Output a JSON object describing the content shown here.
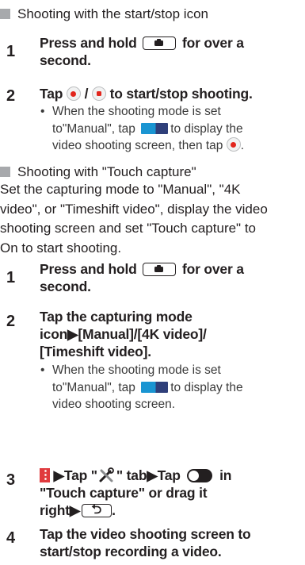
{
  "section1": {
    "heading": "Shooting with the start/stop icon",
    "steps": [
      {
        "num": "1",
        "text_a": "Press and hold",
        "text_b": "for over a",
        "text_c": "second."
      },
      {
        "num": "2",
        "text_a": "Tap",
        "text_b": "/",
        "text_c": "to start/stop shooting."
      }
    ],
    "note": {
      "line1": "When the shooting mode is set",
      "line2_a": "to\"Manual\", tap",
      "line2_b": "to display the",
      "line3_a": "video shooting screen, then tap",
      "line3_b": "."
    }
  },
  "section2": {
    "heading": "Shooting with \"Touch capture\"",
    "para_lines": [
      "Set the capturing mode to \"Manual\", \"4K",
      "video\", or \"Timeshift video\", display the video",
      "shooting screen and set \"Touch capture\" to",
      "On to start shooting."
    ],
    "steps": [
      {
        "num": "1",
        "text_a": "Press and hold",
        "text_b": "for over a",
        "text_c": "second."
      },
      {
        "num": "2",
        "line1": "Tap the capturing mode",
        "line2": "icon▶[Manual]/[4K video]/",
        "line3": "[Timeshift video]."
      },
      {
        "num": "3",
        "part1": "▶Tap \"",
        "part2": "\" tab▶Tap",
        "part3": "in",
        "line2": "\"Touch capture\" or drag it",
        "line3": "right▶",
        "line3_end": "."
      },
      {
        "num": "4",
        "line1": "Tap the video shooting screen to",
        "line2": "start/stop recording a video."
      }
    ],
    "note": {
      "line1": "When the shooting mode is set",
      "line2_a": "to\"Manual\", tap",
      "line2_b": "to display the",
      "line3": "video shooting screen."
    }
  },
  "bullet_char": "•",
  "icons": {
    "camera_key": "camera-key-icon",
    "record": "record-start-icon",
    "stop": "record-stop-icon",
    "mode": "camera-video-mode-icon",
    "menu": "menu-icon",
    "tools": "tools-icon",
    "toggle": "toggle-off-icon",
    "back": "back-key-icon"
  },
  "colors": {
    "heading_square": "#a7a9ac",
    "record_red": "#e2261d",
    "mode_blue": "#1a95d2",
    "menu_red": "#e03a3e"
  }
}
